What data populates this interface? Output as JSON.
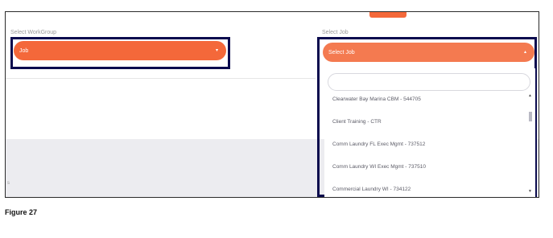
{
  "workgroup": {
    "label": "Select WorkGroup",
    "selected": "Job",
    "caret": "▾"
  },
  "job": {
    "label": "Select Job",
    "placeholder": "Select Job",
    "caret": "▴",
    "search_value": "",
    "options": [
      "Clearwater Bay Marina CBM - 544705",
      "Client Training - CTR",
      "Comm Laundry FL Exec Mgmt - 737512",
      "Comm Laundry WI Exec Mgmt - 737510",
      "Commercial Laundry WI - 734122"
    ]
  },
  "scrollbar": {
    "up": "▲",
    "down": "▼"
  },
  "corner_mark": "s",
  "caption": "Figure 27",
  "colors": {
    "accent": "#f4683a",
    "highlight_border": "#0b0b4e",
    "panel_grey": "#ececf0"
  }
}
